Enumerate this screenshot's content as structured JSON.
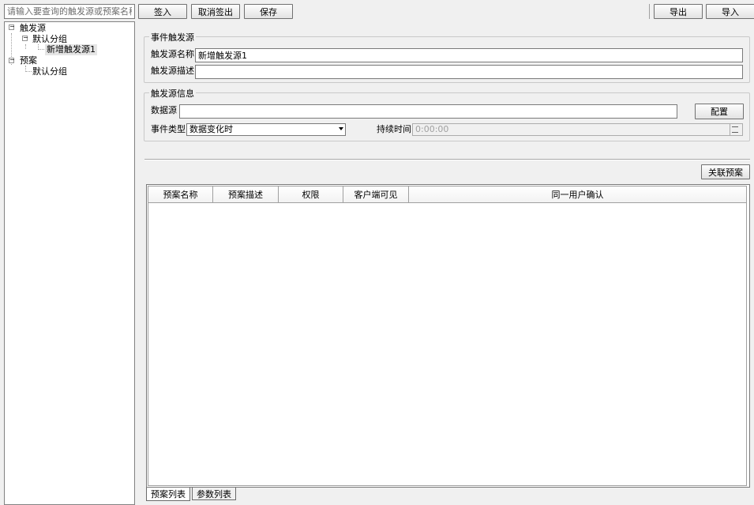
{
  "search": {
    "placeholder": "请输入要查询的触发源或预案名称"
  },
  "toolbar": {
    "checkin_label": "签入",
    "cancel_checkout_label": "取消签出",
    "save_label": "保存",
    "export_label": "导出",
    "import_label": "导入"
  },
  "tree": {
    "triggers_label": "触发源",
    "triggers_group_label": "默认分组",
    "trigger_item_label": "新增触发源1",
    "plans_label": "预案",
    "plans_group_label": "默认分组",
    "expand_symbol": "−"
  },
  "event_source": {
    "title": "事件触发源",
    "name_label": "触发源名称",
    "name_value": "新增触发源1",
    "desc_label": "触发源描述",
    "desc_value": ""
  },
  "trigger_info": {
    "title": "触发源信息",
    "datasource_label": "数据源",
    "datasource_value": "",
    "config_label": "配置",
    "event_type_label": "事件类型",
    "event_type_value": "数据变化时",
    "duration_label": "持续时间",
    "duration_value": "0:00:00"
  },
  "plans": {
    "link_button_label": "关联预案",
    "columns": [
      "预案名称",
      "预案描述",
      "权限",
      "客户端可见",
      "同一用户确认"
    ],
    "rows": []
  },
  "tabs": [
    "预案列表",
    "参数列表"
  ],
  "colors": {
    "background": "#f0f0f0",
    "border": "#7a7a7a",
    "selected": "#e5e5e5"
  }
}
